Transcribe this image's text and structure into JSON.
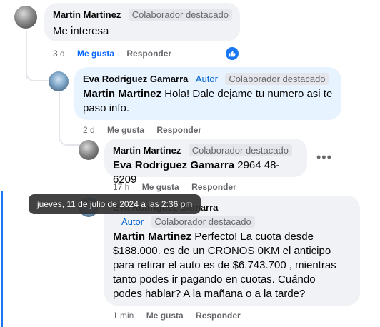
{
  "comments": [
    {
      "author": "Martin Martinez",
      "badge": "Colaborador destacado",
      "text": "Me interesa",
      "time": "3 d",
      "like_label": "Me gusta",
      "reply_label": "Responder"
    },
    {
      "author": "Eva Rodriguez Gamarra",
      "author_tag": "Autor",
      "badge": "Colaborador destacado",
      "mention": "Martin Martinez",
      "text_line1": "Hola! Dale dejame tu numero asi te",
      "text_line2": "paso info.",
      "time": "2 d",
      "like_label": "Me gusta",
      "reply_label": "Responder"
    },
    {
      "author": "Martin Martinez",
      "badge": "Colaborador destacado",
      "mention": "Eva Rodriguez Gamarra",
      "text": "2964 48-6209",
      "time": "17 h",
      "like_label": "Me gusta",
      "reply_label": "Responder"
    },
    {
      "author": "Eva Rodriguez Gamarra",
      "author_tag": "Autor",
      "badge": "Colaborador destacado",
      "mention": "Martin Martinez",
      "text_line1": "Perfecto! La cuota desde",
      "text_line2": "$188.000. es de un CRONOS 0KM el anticipo",
      "text_line3": "para retirar el auto es de $6.743.700 , mientras",
      "text_line4": "tanto podes ir pagando en cuotas. Cuándo",
      "text_line5": "podes hablar? A la mañana o a la tarde?",
      "time": "1 min",
      "like_label": "Me gusta",
      "reply_label": "Responder"
    }
  ],
  "tooltip": "jueves, 11 de julio de 2024 a las 2:36 pm",
  "icons": {
    "like_reaction": "thumbs-up-icon",
    "more": "more-options-icon"
  },
  "colors": {
    "accent": "#1877f2",
    "like_active": "#0866ff",
    "author_tag": "#0064d1"
  }
}
